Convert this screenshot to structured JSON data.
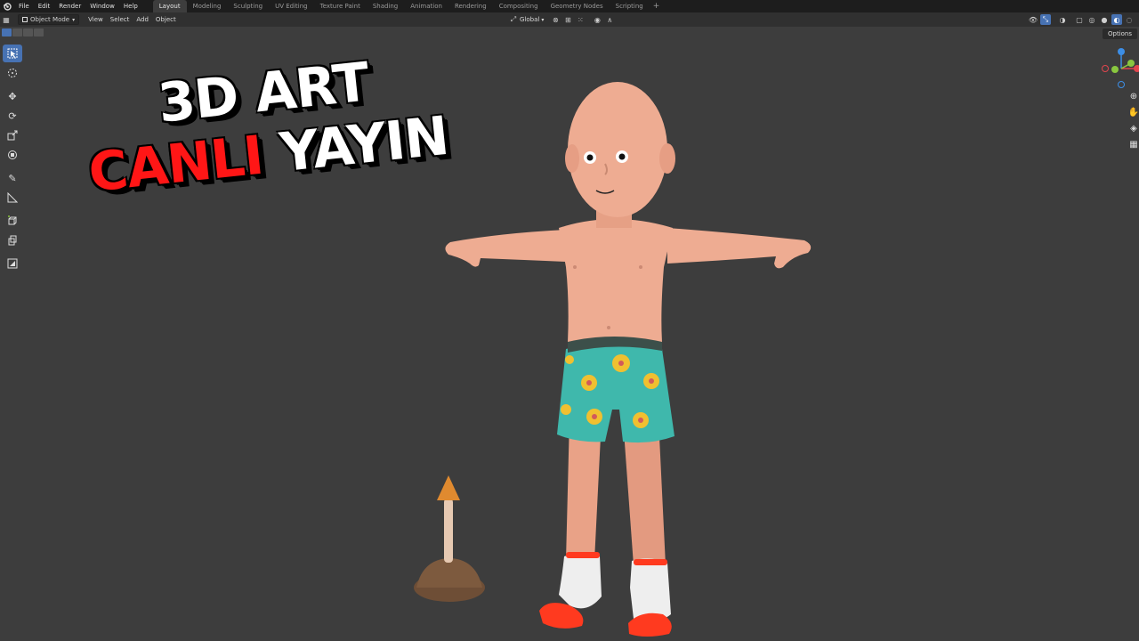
{
  "menubar": {
    "items": [
      "File",
      "Edit",
      "Render",
      "Window",
      "Help"
    ],
    "tabs": [
      "Layout",
      "Modeling",
      "Sculpting",
      "UV Editing",
      "Texture Paint",
      "Shading",
      "Animation",
      "Rendering",
      "Compositing",
      "Geometry Nodes",
      "Scripting"
    ],
    "active_tab": "Layout",
    "add_tab": "+"
  },
  "header": {
    "mode": "Object Mode",
    "menus": [
      "View",
      "Select",
      "Add",
      "Object"
    ],
    "orientation": "Global"
  },
  "options_label": "Options",
  "toolbar": {
    "tools": [
      "select-box-tool",
      "cursor-tool",
      "move-tool",
      "rotate-tool",
      "scale-tool",
      "transform-tool",
      "annotate-tool",
      "measure-tool",
      "add-cube-tool",
      "extrude-tool",
      "image-tool"
    ]
  },
  "overlay": {
    "line1": "3D ART",
    "line2_red": "CANLI",
    "line2_white": "YAYIN"
  },
  "gizmo": {
    "x_color": "#e0454e",
    "y_color": "#8ac73f",
    "z_color": "#3c8ee6"
  },
  "colors": {
    "viewport": "#3d3d3d",
    "accent": "#4772b3",
    "text_red": "#ff1616"
  }
}
